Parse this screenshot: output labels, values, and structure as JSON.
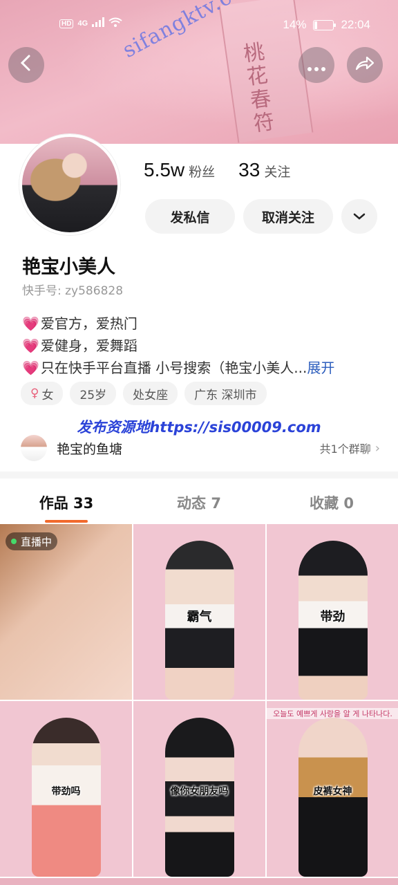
{
  "status_bar": {
    "network_badge": "HD",
    "signal_type": "4G",
    "battery_percent": "14%",
    "battery_level": 0.14,
    "time": "22:04"
  },
  "banner": {
    "charm_text": "桃花春符",
    "watermark": "sifangktv.com"
  },
  "header": {
    "back_icon": "chevron-left-icon",
    "more_icon": "more-dots-icon",
    "share_icon": "share-arrow-icon"
  },
  "profile": {
    "fans_count": "5.5w",
    "fans_label": "粉丝",
    "following_count": "33",
    "following_label": "关注",
    "message_button": "发私信",
    "unfollow_button": "取消关注",
    "dropdown_icon": "chevron-down-icon",
    "nickname": "艳宝小美人",
    "kuaishou_id": "快手号: zy586828",
    "bio": [
      "爱官方，爱热门",
      "爱健身，爱舞蹈",
      "只在快手平台直播 小号搜索（艳宝小美人..."
    ],
    "bio_expand": "展开",
    "tags": [
      "女",
      "25岁",
      "处女座",
      "广东 深圳市"
    ]
  },
  "watermark_mid": "发布资源地https://sis00009.com",
  "group": {
    "name": "艳宝的鱼塘",
    "count": "共1个群聊"
  },
  "tabs": [
    {
      "label": "作品 33",
      "active": true
    },
    {
      "label": "动态 7",
      "active": false
    },
    {
      "label": "收藏 0",
      "active": false
    }
  ],
  "grid": [
    {
      "caption": "",
      "live": "直播中",
      "palette": [
        "#8a5a40",
        "#e7b9a4"
      ]
    },
    {
      "caption": "霸气",
      "live": "",
      "palette": [
        "#222226",
        "#f0e8e3"
      ]
    },
    {
      "caption": "带劲",
      "live": "",
      "palette": [
        "#1d1d21",
        "#efe9e6"
      ]
    },
    {
      "caption": "带劲吗",
      "live": "",
      "palette": [
        "#ef8a82",
        "#f7efea"
      ]
    },
    {
      "caption": "像你女朋友吗",
      "live": "",
      "palette": [
        "#1a1a1c",
        "#f1d9cf"
      ]
    },
    {
      "caption": "皮裤女神",
      "live": "",
      "palette": [
        "#141416",
        "#c9924e"
      ],
      "banner": "오늘도 예쁘게 사랑을 알 게 나타나다."
    }
  ],
  "colors": {
    "accent_underline": "#f26a2d",
    "link_blue": "#2c5dbd",
    "watermark_blue": "#2b43d8",
    "heart_pink": "#ec5d9a"
  }
}
